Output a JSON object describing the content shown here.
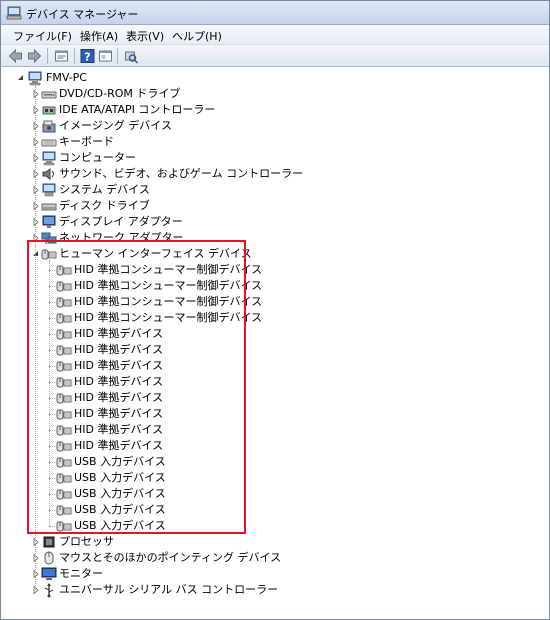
{
  "window": {
    "title": "デバイス マネージャー"
  },
  "menu": [
    {
      "label": "ファイル(F)"
    },
    {
      "label": "操作(A)"
    },
    {
      "label": "表示(V)"
    },
    {
      "label": "ヘルプ(H)"
    }
  ],
  "tree": {
    "root": "FMV-PC",
    "categories": [
      {
        "label": "DVD/CD-ROM ドライブ",
        "icon": "dvd-drive-icon"
      },
      {
        "label": "IDE ATA/ATAPI コントローラー",
        "icon": "ide-controller-icon"
      },
      {
        "label": "イメージング デバイス",
        "icon": "imaging-device-icon"
      },
      {
        "label": "キーボード",
        "icon": "keyboard-icon"
      },
      {
        "label": "コンピューター",
        "icon": "computer-icon"
      },
      {
        "label": "サウンド、ビデオ、およびゲーム コントローラー",
        "icon": "sound-icon"
      },
      {
        "label": "システム デバイス",
        "icon": "system-device-icon"
      },
      {
        "label": "ディスク ドライブ",
        "icon": "disk-drive-icon"
      },
      {
        "label": "ディスプレイ アダプター",
        "icon": "display-adapter-icon"
      },
      {
        "label": "ネットワーク アダプター",
        "icon": "network-adapter-icon"
      }
    ],
    "expanded": {
      "label": "ヒューマン インターフェイス デバイス",
      "children": [
        "HID 準拠コンシューマー制御デバイス",
        "HID 準拠コンシューマー制御デバイス",
        "HID 準拠コンシューマー制御デバイス",
        "HID 準拠コンシューマー制御デバイス",
        "HID 準拠デバイス",
        "HID 準拠デバイス",
        "HID 準拠デバイス",
        "HID 準拠デバイス",
        "HID 準拠デバイス",
        "HID 準拠デバイス",
        "HID 準拠デバイス",
        "HID 準拠デバイス",
        "USB 入力デバイス",
        "USB 入力デバイス",
        "USB 入力デバイス",
        "USB 入力デバイス",
        "USB 入力デバイス"
      ]
    },
    "after": [
      {
        "label": "プロセッサ",
        "icon": "processor-icon"
      },
      {
        "label": "マウスとそのほかのポインティング デバイス",
        "icon": "mouse-icon"
      },
      {
        "label": "モニター",
        "icon": "monitor-icon"
      },
      {
        "label": "ユニバーサル シリアル バス コントローラー",
        "icon": "usb-controller-icon"
      }
    ]
  },
  "colors": {
    "highlight": "#e8102a"
  }
}
